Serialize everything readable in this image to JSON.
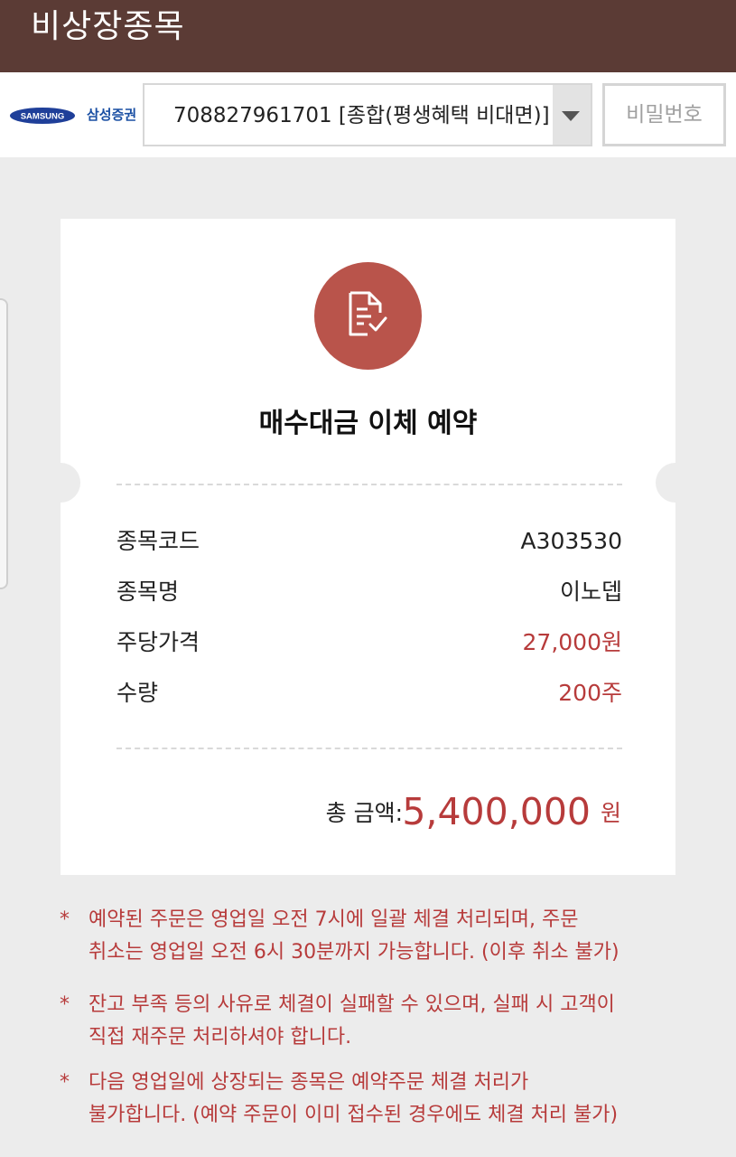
{
  "header": {
    "title": "비상장종목"
  },
  "account": {
    "brand_logo_text": "SAMSUNG",
    "brand_name": "삼성증권",
    "selected": "708827961701 [종합(평생혜택 비대면)]",
    "password_placeholder": "비밀번호"
  },
  "card": {
    "title": "매수대금 이체 예약",
    "rows": [
      {
        "label": "종목코드",
        "value": "A303530"
      },
      {
        "label": "종목명",
        "value": "이노뎁"
      },
      {
        "label": "주당가격",
        "value": "27,000원"
      },
      {
        "label": "수량",
        "value": "200주"
      }
    ],
    "total_label": "총 금액:",
    "total_amount": "5,400,000",
    "total_unit": "원"
  },
  "notes": [
    {
      "bullet": "*",
      "text_line1": "예약된 주문은 영업일 오전 7시에 일괄 체결 처리되며, 주문",
      "text_line2": "취소는 영업일 오전 6시 30분까지 가능합니다. (이후 취소 불가)"
    },
    {
      "bullet": "*",
      "text_line1": "잔고 부족 등의 사유로 체결이 실패할 수 있으며, 실패 시 고객이",
      "text_line2": "직접 재주문 처리하셔야 합니다."
    },
    {
      "bullet": "*",
      "text_line1": "다음 영업일에 상장되는 종목은 예약주문 체결 처리가",
      "text_line2": "불가합니다. (예약 주문이 이미 접수된 경우에도 체결 처리 불가)"
    }
  ],
  "colors": {
    "header_bg": "#5b3b35",
    "accent_red": "#b73b3b",
    "icon_circle": "#b9544b",
    "brand_blue": "#1a4fa3"
  },
  "icons": {
    "select_arrow": "caret-down-icon",
    "document_check": "document-check-icon"
  }
}
